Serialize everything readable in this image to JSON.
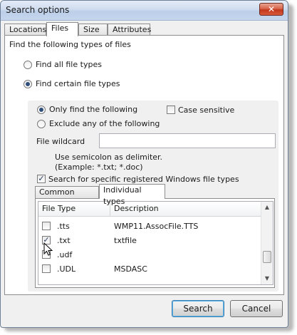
{
  "window": {
    "title": "Search options",
    "close_glyph": "✕"
  },
  "tabs": [
    "Locations",
    "Files",
    "Size",
    "Attributes"
  ],
  "files": {
    "section_label": "Find the following types of files",
    "find_all_label": "Find all file types",
    "find_certain_label": "Find certain file types",
    "selected_mode": "Find certain file types",
    "only_find_label": "Only find the following",
    "exclude_label": "Exclude any of the following",
    "case_sensitive_label": "Case sensitive",
    "case_sensitive_checked": false,
    "wildcard_label": "File wildcard",
    "wildcard_value": "",
    "hint_line1": "Use semicolon as delimiter.",
    "hint_line2": "(Example: *.txt; *.doc)",
    "registered_label": "Search for specific registered Windows file types",
    "registered_checked": true,
    "subtabs": [
      "Common Groups",
      "Individual types"
    ],
    "active_subtab": "Individual types",
    "columns": [
      "File Type",
      "Description"
    ],
    "rows": [
      {
        "ext": ".tts",
        "desc": "WMP11.AssocFile.TTS",
        "checked": false
      },
      {
        "ext": ".txt",
        "desc": "txtfile",
        "checked": true
      },
      {
        "ext": ".udf",
        "desc": "",
        "checked": false
      },
      {
        "ext": ".UDL",
        "desc": "MSDASC",
        "checked": false
      }
    ]
  },
  "buttons": {
    "search": "Search",
    "cancel": "Cancel"
  },
  "icons": {
    "close": "close-icon",
    "scroll_up": "scroll-up-icon",
    "scroll_down": "scroll-down-icon",
    "cursor": "mouse-pointer-icon"
  }
}
